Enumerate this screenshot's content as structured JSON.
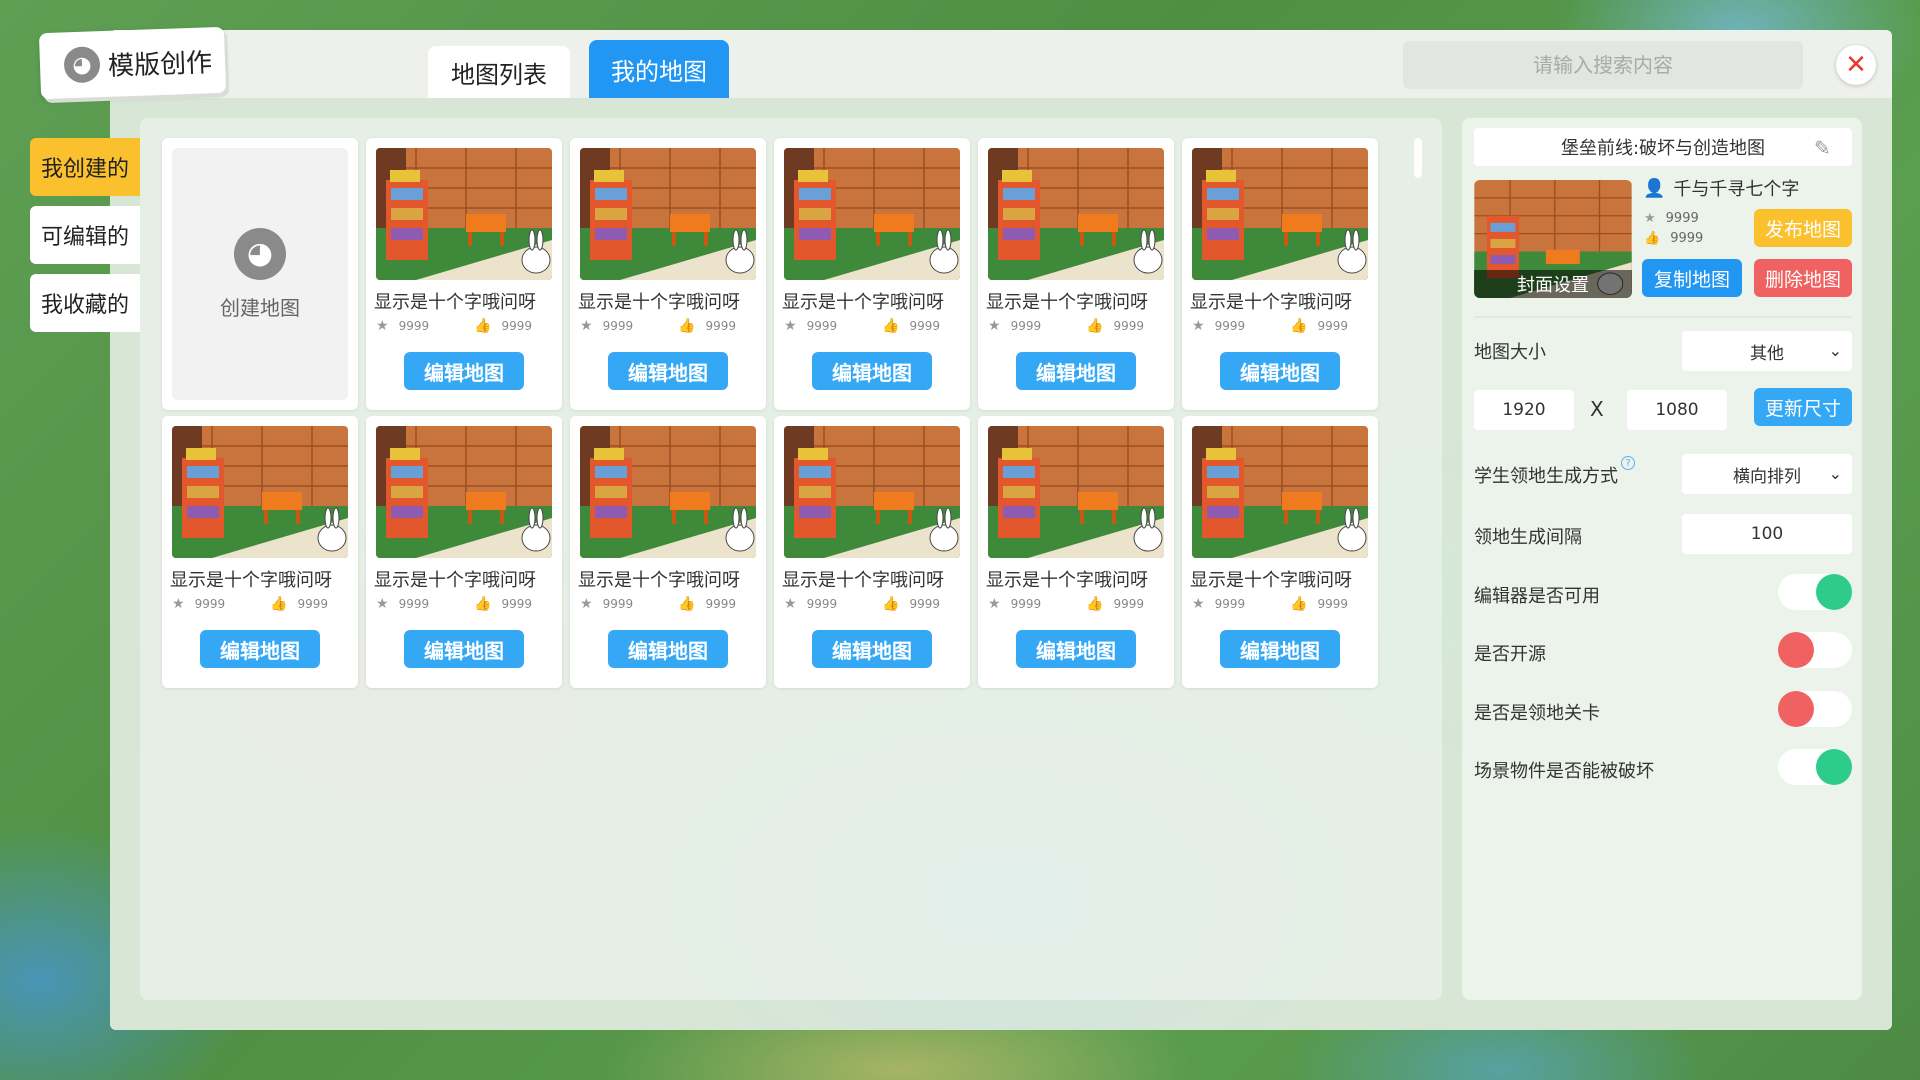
{
  "header": {
    "title": "模版创作",
    "tabs": [
      {
        "label": "地图列表",
        "active": false
      },
      {
        "label": "我的地图",
        "active": true
      }
    ],
    "search_placeholder": "请输入搜索内容",
    "close_icon": "close-icon"
  },
  "sidebar": {
    "items": [
      {
        "label": "我创建的",
        "active": true
      },
      {
        "label": "可编辑的",
        "active": false
      },
      {
        "label": "我收藏的",
        "active": false
      }
    ]
  },
  "grid": {
    "create_label": "创建地图",
    "cards": [
      {
        "title": "显示是十个字哦问呀",
        "stars": "9999",
        "likes": "9999",
        "button": "编辑地图"
      },
      {
        "title": "显示是十个字哦问呀",
        "stars": "9999",
        "likes": "9999",
        "button": "编辑地图"
      },
      {
        "title": "显示是十个字哦问呀",
        "stars": "9999",
        "likes": "9999",
        "button": "编辑地图"
      },
      {
        "title": "显示是十个字哦问呀",
        "stars": "9999",
        "likes": "9999",
        "button": "编辑地图"
      },
      {
        "title": "显示是十个字哦问呀",
        "stars": "9999",
        "likes": "9999",
        "button": "编辑地图"
      },
      {
        "title": "显示是十个字哦问呀",
        "stars": "9999",
        "likes": "9999",
        "button": "编辑地图"
      },
      {
        "title": "显示是十个字哦问呀",
        "stars": "9999",
        "likes": "9999",
        "button": "编辑地图"
      },
      {
        "title": "显示是十个字哦问呀",
        "stars": "9999",
        "likes": "9999",
        "button": "编辑地图"
      },
      {
        "title": "显示是十个字哦问呀",
        "stars": "9999",
        "likes": "9999",
        "button": "编辑地图"
      },
      {
        "title": "显示是十个字哦问呀",
        "stars": "9999",
        "likes": "9999",
        "button": "编辑地图"
      },
      {
        "title": "显示是十个字哦问呀",
        "stars": "9999",
        "likes": "9999",
        "button": "编辑地图"
      }
    ]
  },
  "detail": {
    "map_name": "堡垒前线:破坏与创造地图",
    "cover_label": "封面设置",
    "author": "千与千寻七个字",
    "stars": "9999",
    "likes": "9999",
    "publish_label": "发布地图",
    "copy_label": "复制地图",
    "delete_label": "删除地图",
    "size_label": "地图大小",
    "size_option": "其他",
    "width": "1920",
    "x_sep": "X",
    "height": "1080",
    "update_label": "更新尺寸",
    "gen_mode_label": "学生领地生成方式",
    "gen_mode_value": "横向排列",
    "gap_label": "领地生成间隔",
    "gap_value": "100",
    "toggles": [
      {
        "label": "编辑器是否可用",
        "on": true
      },
      {
        "label": "是否开源",
        "on": false
      },
      {
        "label": "是否是领地关卡",
        "on": false
      },
      {
        "label": "场景物件是否能被破坏",
        "on": true
      }
    ]
  },
  "colors": {
    "accent_blue": "#2196f3",
    "button_blue": "#34a8f5",
    "yellow": "#fbc02d",
    "red": "#f06262",
    "green": "#2ecc8a"
  }
}
